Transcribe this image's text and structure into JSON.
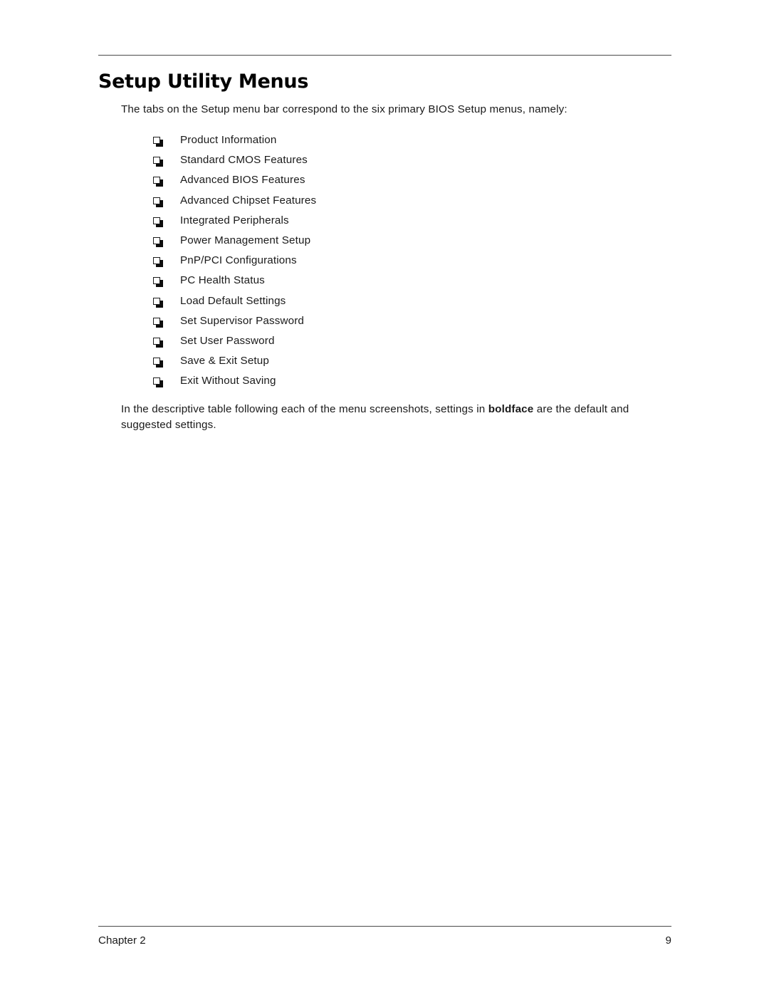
{
  "document": {
    "heading": "Setup Utility Menus",
    "intro": "The tabs on the Setup menu bar correspond to the six primary BIOS Setup menus, namely:",
    "menu_items": [
      "Product Information",
      "Standard CMOS Features",
      "Advanced BIOS Features",
      "Advanced Chipset Features",
      "Integrated Peripherals",
      "Power Management Setup",
      "PnP/PCI Configurations",
      "PC Health Status",
      "Load Default Settings",
      "Set Supervisor Password",
      "Set User Password",
      "Save & Exit Setup",
      "Exit Without Saving"
    ],
    "closing": {
      "before_bold": "In the descriptive table following each of the menu screenshots, settings in ",
      "bold": "boldface",
      "after_bold": " are the default and suggested settings."
    },
    "bullet_icon": "shadowed-square-bullet"
  },
  "footer": {
    "chapter": "Chapter 2",
    "page_number": "9"
  },
  "colors": {
    "text": "#1a1a1a",
    "rule": "#4a4a4a",
    "background": "#ffffff"
  }
}
